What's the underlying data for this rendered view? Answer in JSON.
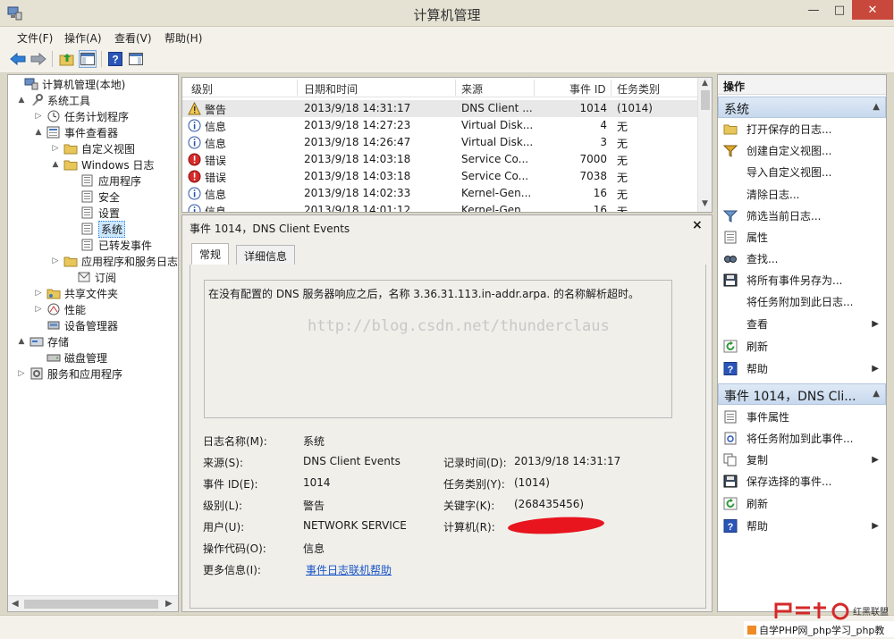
{
  "window": {
    "title": "计算机管理"
  },
  "menu": [
    "文件(F)",
    "操作(A)",
    "查看(V)",
    "帮助(H)"
  ],
  "tree": [
    {
      "label": "计算机管理(本地)",
      "icon": "computer-mgmt-icon",
      "exp": ""
    },
    {
      "label": "系统工具",
      "icon": "tools-icon",
      "exp": "▲"
    },
    {
      "label": "任务计划程序",
      "icon": "clock-icon",
      "exp": "▷"
    },
    {
      "label": "事件查看器",
      "icon": "event-viewer-icon",
      "exp": "▲"
    },
    {
      "label": "自定义视图",
      "icon": "folder-icon",
      "exp": "▷"
    },
    {
      "label": "Windows 日志",
      "icon": "folder-icon",
      "exp": "▲"
    },
    {
      "label": "应用程序",
      "icon": "log-icon",
      "exp": ""
    },
    {
      "label": "安全",
      "icon": "log-icon",
      "exp": ""
    },
    {
      "label": "设置",
      "icon": "log-icon",
      "exp": ""
    },
    {
      "label": "系统",
      "icon": "log-icon",
      "exp": ""
    },
    {
      "label": "已转发事件",
      "icon": "log-icon",
      "exp": ""
    },
    {
      "label": "应用程序和服务日志",
      "icon": "folder-icon",
      "exp": "▷"
    },
    {
      "label": "订阅",
      "icon": "subscription-icon",
      "exp": ""
    },
    {
      "label": "共享文件夹",
      "icon": "shared-folder-icon",
      "exp": "▷"
    },
    {
      "label": "性能",
      "icon": "performance-icon",
      "exp": "▷"
    },
    {
      "label": "设备管理器",
      "icon": "device-manager-icon",
      "exp": ""
    },
    {
      "label": "存储",
      "icon": "storage-icon",
      "exp": "▲"
    },
    {
      "label": "磁盘管理",
      "icon": "disk-icon",
      "exp": ""
    },
    {
      "label": "服务和应用程序",
      "icon": "services-icon",
      "exp": "▷"
    }
  ],
  "events": {
    "columns": [
      "级别",
      "日期和时间",
      "来源",
      "事件 ID",
      "任务类别"
    ],
    "rows": [
      {
        "level": "警告",
        "type": "warning",
        "datetime": "2013/9/18 14:31:17",
        "source": "DNS Client ...",
        "id": "1014",
        "category": "(1014)"
      },
      {
        "level": "信息",
        "type": "info",
        "datetime": "2013/9/18 14:27:23",
        "source": "Virtual Disk...",
        "id": "4",
        "category": "无"
      },
      {
        "level": "信息",
        "type": "info",
        "datetime": "2013/9/18 14:26:47",
        "source": "Virtual Disk...",
        "id": "3",
        "category": "无"
      },
      {
        "level": "错误",
        "type": "error",
        "datetime": "2013/9/18 14:03:18",
        "source": "Service Co...",
        "id": "7000",
        "category": "无"
      },
      {
        "level": "错误",
        "type": "error",
        "datetime": "2013/9/18 14:03:18",
        "source": "Service Co...",
        "id": "7038",
        "category": "无"
      },
      {
        "level": "信息",
        "type": "info",
        "datetime": "2013/9/18 14:02:33",
        "source": "Kernel-Gen...",
        "id": "16",
        "category": "无"
      },
      {
        "level": "信息",
        "type": "info",
        "datetime": "2013/9/18 14:01:12",
        "source": "Kernel-Gen...",
        "id": "16",
        "category": "无"
      }
    ]
  },
  "detail": {
    "title": "事件 1014，DNS Client Events",
    "close": "×",
    "tabs": [
      "常规",
      "详细信息"
    ],
    "description": "在没有配置的 DNS 服务器响应之后，名称 3.36.31.113.in-addr.arpa. 的名称解析超时。",
    "watermark": "http://blog.csdn.net/thunderclaus",
    "fields": {
      "log_name_label": "日志名称(M):",
      "log_name": "系统",
      "source_label": "来源(S):",
      "source": "DNS Client Events",
      "logged_label": "记录时间(D):",
      "logged": "2013/9/18 14:31:17",
      "event_id_label": "事件 ID(E):",
      "event_id": "1014",
      "task_label": "任务类别(Y):",
      "task": "(1014)",
      "level_label": "级别(L):",
      "level": "警告",
      "keywords_label": "关键字(K):",
      "keywords": "(268435456)",
      "user_label": "用户(U):",
      "user": "NETWORK SERVICE",
      "computer_label": "计算机(R):",
      "opcode_label": "操作代码(O):",
      "opcode": "信息",
      "more_info_label": "更多信息(I):",
      "more_info_link": "事件日志联机帮助"
    }
  },
  "actions": {
    "title": "操作",
    "section1": "系统",
    "items1": [
      {
        "label": "打开保存的日志...",
        "icon": "open-log-icon",
        "arrow": ""
      },
      {
        "label": "创建自定义视图...",
        "icon": "filter-icon",
        "arrow": ""
      },
      {
        "label": "导入自定义视图...",
        "icon": "",
        "arrow": ""
      },
      {
        "label": "清除日志...",
        "icon": "",
        "arrow": ""
      },
      {
        "label": "筛选当前日志...",
        "icon": "filter-icon",
        "arrow": ""
      },
      {
        "label": "属性",
        "icon": "properties-icon",
        "arrow": ""
      },
      {
        "label": "查找...",
        "icon": "find-icon",
        "arrow": ""
      },
      {
        "label": "将所有事件另存为...",
        "icon": "save-icon",
        "arrow": ""
      },
      {
        "label": "将任务附加到此日志...",
        "icon": "",
        "arrow": ""
      },
      {
        "label": "查看",
        "icon": "",
        "arrow": "▶"
      },
      {
        "label": "刷新",
        "icon": "refresh-icon",
        "arrow": ""
      },
      {
        "label": "帮助",
        "icon": "help-icon",
        "arrow": "▶"
      }
    ],
    "section2": "事件 1014，DNS Cli...",
    "items2": [
      {
        "label": "事件属性",
        "icon": "properties-icon",
        "arrow": ""
      },
      {
        "label": "将任务附加到此事件...",
        "icon": "attach-icon",
        "arrow": ""
      },
      {
        "label": "复制",
        "icon": "copy-icon",
        "arrow": "▶"
      },
      {
        "label": "保存选择的事件...",
        "icon": "save-icon",
        "arrow": ""
      },
      {
        "label": "刷新",
        "icon": "refresh-icon",
        "arrow": ""
      },
      {
        "label": "帮助",
        "icon": "help-icon",
        "arrow": "▶"
      }
    ]
  },
  "stamp": {
    "brand": "红黑联盟",
    "caption": "自学PHP网_php学习_php教"
  }
}
